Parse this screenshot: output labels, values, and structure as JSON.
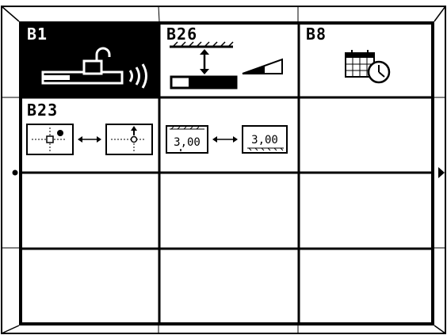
{
  "menu": {
    "cells": [
      {
        "code": "B1",
        "selected": true
      },
      {
        "code": "B26",
        "selected": false
      },
      {
        "code": "B8",
        "selected": false
      },
      {
        "code": "B23",
        "selected": false
      },
      {
        "code": "",
        "selected": false
      },
      {
        "code": "",
        "selected": false
      },
      {
        "code": "",
        "selected": false
      },
      {
        "code": "",
        "selected": false
      },
      {
        "code": "",
        "selected": false
      },
      {
        "code": "",
        "selected": false
      },
      {
        "code": "",
        "selected": false
      },
      {
        "code": "",
        "selected": false
      }
    ],
    "icons": {
      "b1": "unlock-wireless-icon",
      "b26": "height-adjust-icon",
      "b8": "calendar-clock-icon",
      "b23": "position-move-icon",
      "b23b": "value-transfer-icon"
    },
    "values": {
      "left_value": "3,00",
      "right_value": "3,00"
    }
  }
}
